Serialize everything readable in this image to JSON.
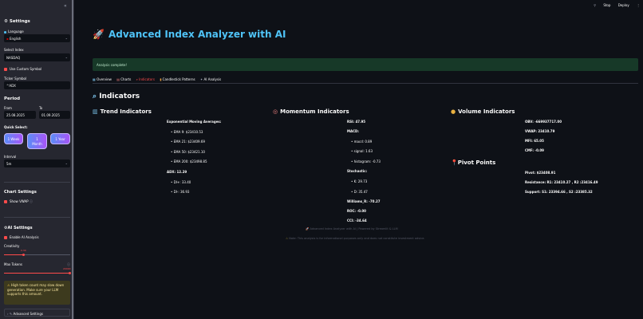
{
  "topbar": {
    "stop_label": "Stop",
    "deploy_label": "Deploy",
    "menu_icon": "⋮"
  },
  "sidebar": {
    "collapse_icon": "«",
    "settings_title": "Settings",
    "language_label": "Language",
    "language_value": "English",
    "index_label": "Select Index",
    "index_value": "NASDAQ",
    "custom_symbol_label": "Use Custom Symbol",
    "ticker_label": "Ticker Symbol",
    "ticker_value": "^ADX",
    "period_title": "Period",
    "from_label": "From",
    "from_value": "25.08.2025",
    "to_label": "To",
    "to_value": "01.09.2025",
    "quick_select_label": "Quick Select:",
    "quick_1": "1 Week",
    "quick_2a": "1",
    "quick_2b": "Month",
    "quick_3": "1 Year",
    "interval_label": "Interval",
    "interval_value": "5m",
    "chart_settings_title": "Chart Settings",
    "show_vwap_label": "Show VWAP",
    "ai_settings_title": "AI Settings",
    "enable_ai_label": "Enable AI Analysis",
    "creativity_label": "Creativity",
    "creativity_value": "0.30",
    "creativity_fraction": 0.3,
    "max_tokens_label": "Max Tokens",
    "max_tokens_value": "20000",
    "max_tokens_fraction": 1.0,
    "warning_text": "High token count may slow down generation. Make sure your LLM supports this amount.",
    "advanced_label": "Advanced Settings"
  },
  "main": {
    "title": "Advanced Index Analyzer with AI",
    "success_text": "Analysis complete!",
    "tabs": [
      "Overview",
      "Charts",
      "Indicators",
      "Candlestick Patterns",
      "AI Analysis"
    ],
    "active_tab": 2,
    "indicators_heading": "Indicators",
    "trend": {
      "title": "Trend Indicators",
      "ema_label": "Exponential Moving Averages:",
      "ema9": "EMA 9: $23410.53",
      "ema21": "EMA 21: $23409.69",
      "ema50": "EMA 50: $23421.10",
      "ema200": "EMA 200: $23498.85",
      "adx": "ADX: 12.29",
      "di_plus": "DI+: 33.40",
      "di_minus": "DI-: 36.93"
    },
    "momentum": {
      "title": "Momentum Indicators",
      "rsi": "RSI: 47.95",
      "macd_label": "MACD:",
      "macd": "macd: 0.89",
      "signal": "signal: 1.63",
      "histogram": "histogram: -0.73",
      "stoch_label": "Stochastic:",
      "k": "K: 29.73",
      "d": "D: 35.47",
      "williams": "Williams_R: -70.27",
      "roc": "ROC: -0.00",
      "cci": "CCI: -34.64"
    },
    "volume": {
      "title": "Volume Indicators",
      "obv": "OBV: -669937717.00",
      "vwap": "VWAP: 23410.79",
      "mfi": "MFI: 65.05",
      "cmf": "CMF: -0.09"
    },
    "pivot": {
      "title": "Pivot Points",
      "pivot": "Pivot: $23408.91",
      "resistance": "Resistance: R1: 23410.27 , R2 :23416.49",
      "support": "Support: S1: 23394.66 , S2 :23385.32"
    },
    "footer1": "Advanced Index Analyzer with AI | Powered by Streamlit & LLM",
    "footer2": "Note: This analysis is for informational purposes only and does not constitute investment advice."
  }
}
